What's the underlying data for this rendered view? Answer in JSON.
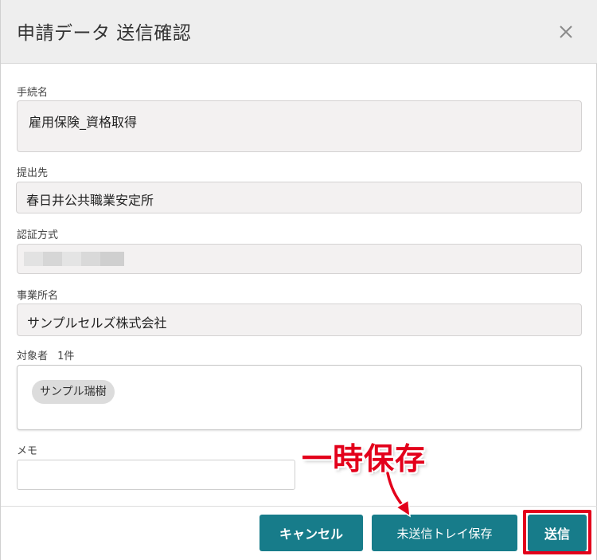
{
  "dialog": {
    "title": "申請データ 送信確認",
    "close_icon": "close-icon"
  },
  "fields": {
    "procedure": {
      "label": "手続名",
      "value": "雇用保険_資格取得"
    },
    "destination": {
      "label": "提出先",
      "value": "春日井公共職業安定所"
    },
    "auth_method": {
      "label": "認証方式",
      "value": ""
    },
    "office": {
      "label": "事業所名",
      "value": "サンプルセルズ株式会社"
    },
    "targets": {
      "label": "対象者",
      "count": "1件",
      "chips": [
        "サンプル瑞樹"
      ]
    },
    "memo": {
      "label": "メモ",
      "value": "",
      "placeholder": ""
    }
  },
  "footer": {
    "cancel_label": "キャンセル",
    "save_tray_label": "未送信トレイ保存",
    "send_label": "送信"
  },
  "annotation": {
    "text": "一時保存",
    "color": "#e3001b"
  },
  "colors": {
    "button": "#177c8a",
    "header_bg": "#eeeeee",
    "field_bg": "#f3f1f1"
  }
}
